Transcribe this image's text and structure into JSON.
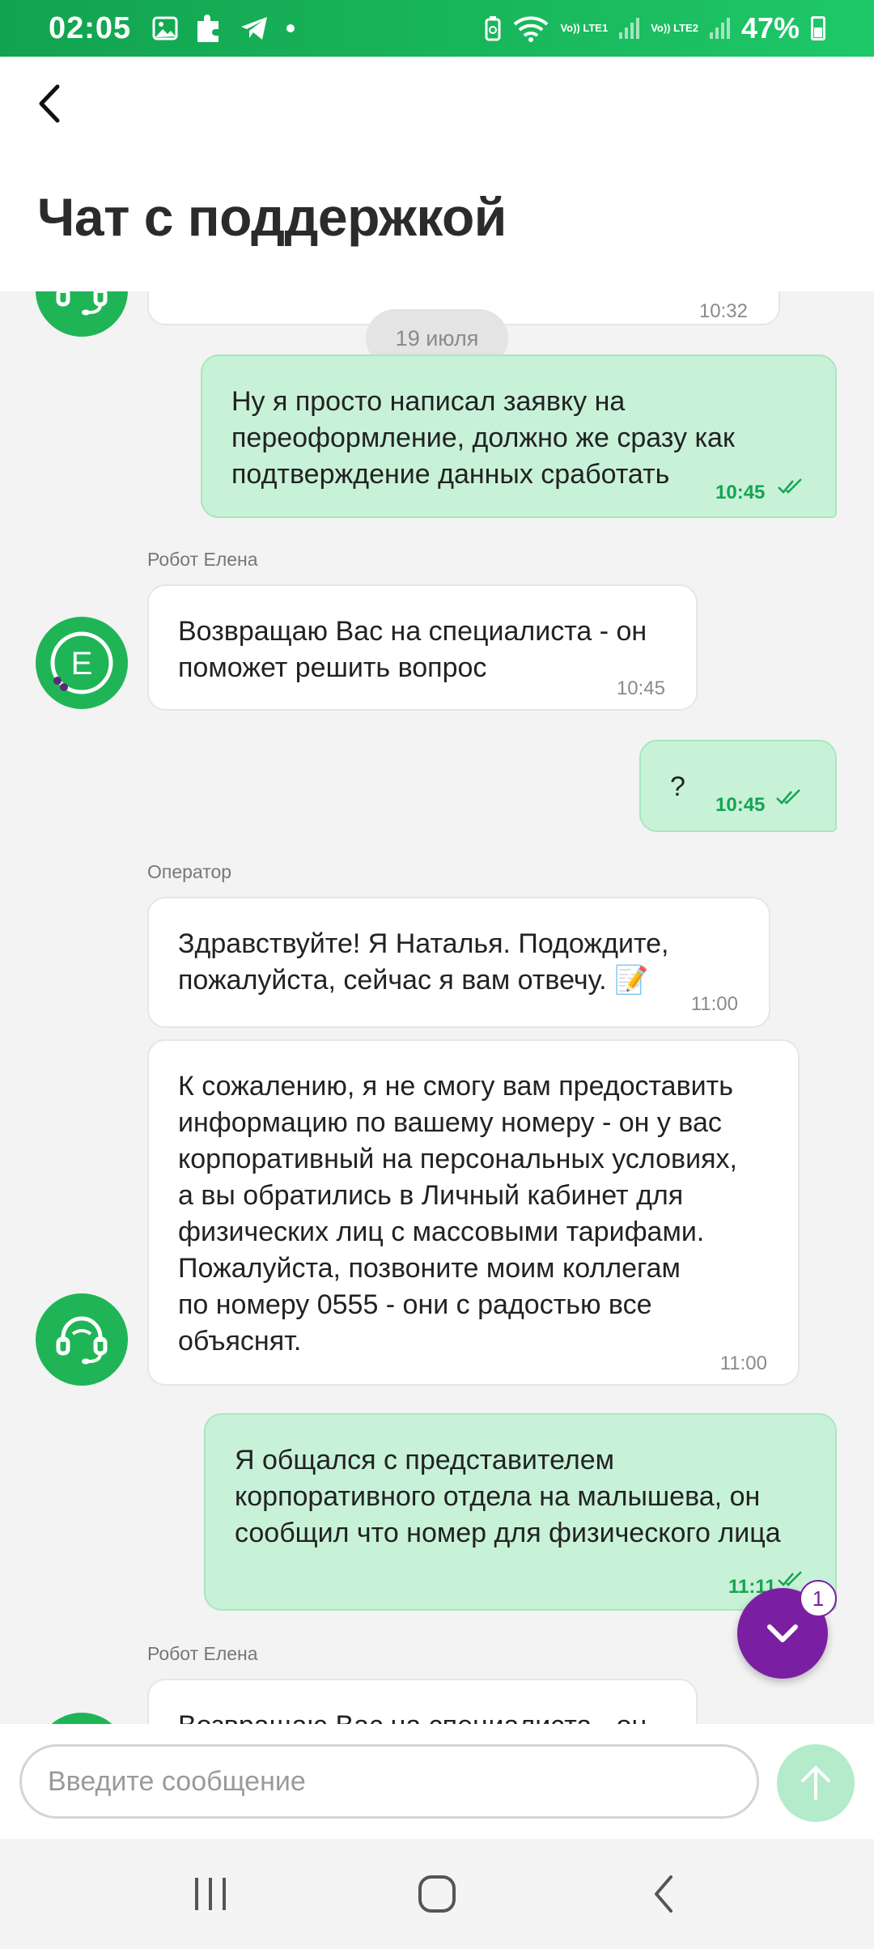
{
  "status_bar": {
    "time": "02:05",
    "net1": "Vo)) LTE1",
    "net2": "Vo)) LTE2",
    "battery": "47%"
  },
  "header": {
    "title": "Чат с поддержкой"
  },
  "chat": {
    "top_partial_time": "10:32",
    "date_divider": "19 июля",
    "messages": [
      {
        "from": "user",
        "text": "Ну я просто написал заявку на\nпереоформление, должно же сразу как\nподтверждение данных сработать",
        "time": "10:45"
      },
      {
        "from": "bot",
        "sender": "Робот Елена",
        "avatar_letter": "E",
        "text": "Возвращаю Вас на специалиста - он\nпоможет решить вопрос",
        "time": "10:45"
      },
      {
        "from": "user",
        "text": "?",
        "time": "10:45"
      },
      {
        "from": "operator",
        "sender": "Оператор",
        "text": "Здравствуйте! Я Наталья. Подождите,\nпожалуйста, сейчас я вам отвечу. 📝",
        "time": "11:00"
      },
      {
        "from": "operator",
        "text": "К сожалению, я не смогу вам предоставить\nинформацию по вашему номеру - он у вас\nкорпоративный на персональных условиях,\nа вы обратились в Личный кабинет для\nфизических лиц с массовыми тарифами.\nПожалуйста, позвоните моим коллегам\nпо номеру 0555 - они с радостью все\nобъяснят.",
        "time": "11:00"
      },
      {
        "from": "user",
        "text": "Я общался с представителем\nкорпоративного отдела на малышева, он\nсообщил что номер для физического лица",
        "time": "11:11"
      },
      {
        "from": "bot",
        "sender": "Робот Елена",
        "text": "Возвращаю Вас на специалиста - он",
        "time": ""
      }
    ]
  },
  "scroll_fab": {
    "badge": "1"
  },
  "composer": {
    "placeholder": "Введите сообщение"
  },
  "colors": {
    "brand_green": "#19b85c",
    "out_bubble": "#c8f2d8",
    "fab_purple": "#7b1fa2"
  },
  "icons": {
    "back": "chevron-left-icon",
    "fab": "chevron-down-icon",
    "send": "arrow-up-icon",
    "operator": "headset-icon"
  }
}
